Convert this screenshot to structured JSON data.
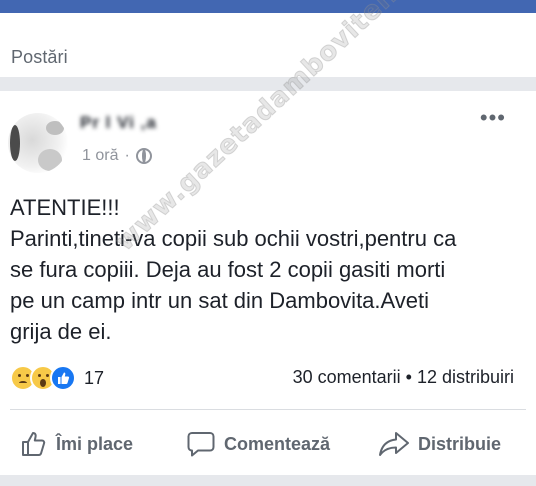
{
  "section": {
    "title": "Postări"
  },
  "post": {
    "author_name": "Pr       l Vi    ,a",
    "time": "1 oră",
    "separator": "·",
    "more": "•••",
    "text_lines": [
      "ATENTIE!!!",
      "Parinti,tineti-va copii sub ochii vostri,pentru ca",
      "se fura copiii. Deja au fost 2 copii gasiti morti",
      "pe un camp intr un sat din Dambovita.Aveti",
      "grija de ei."
    ],
    "watermark": "www.gazetadambovitei.ro"
  },
  "reactions": {
    "icons": [
      "sad-icon",
      "wow-icon",
      "like-icon"
    ],
    "count": "17",
    "colors": {
      "emoji": "#f7c948",
      "like": "#1877f2"
    }
  },
  "stats": {
    "text": "30 comentarii • 12 distribuiri"
  },
  "actions": {
    "like_label": "Îmi place",
    "comment_label": "Comentează",
    "share_label": "Distribuie"
  },
  "colors": {
    "topbar": "#4267b2",
    "muted": "#606770",
    "text": "#1d2129"
  }
}
